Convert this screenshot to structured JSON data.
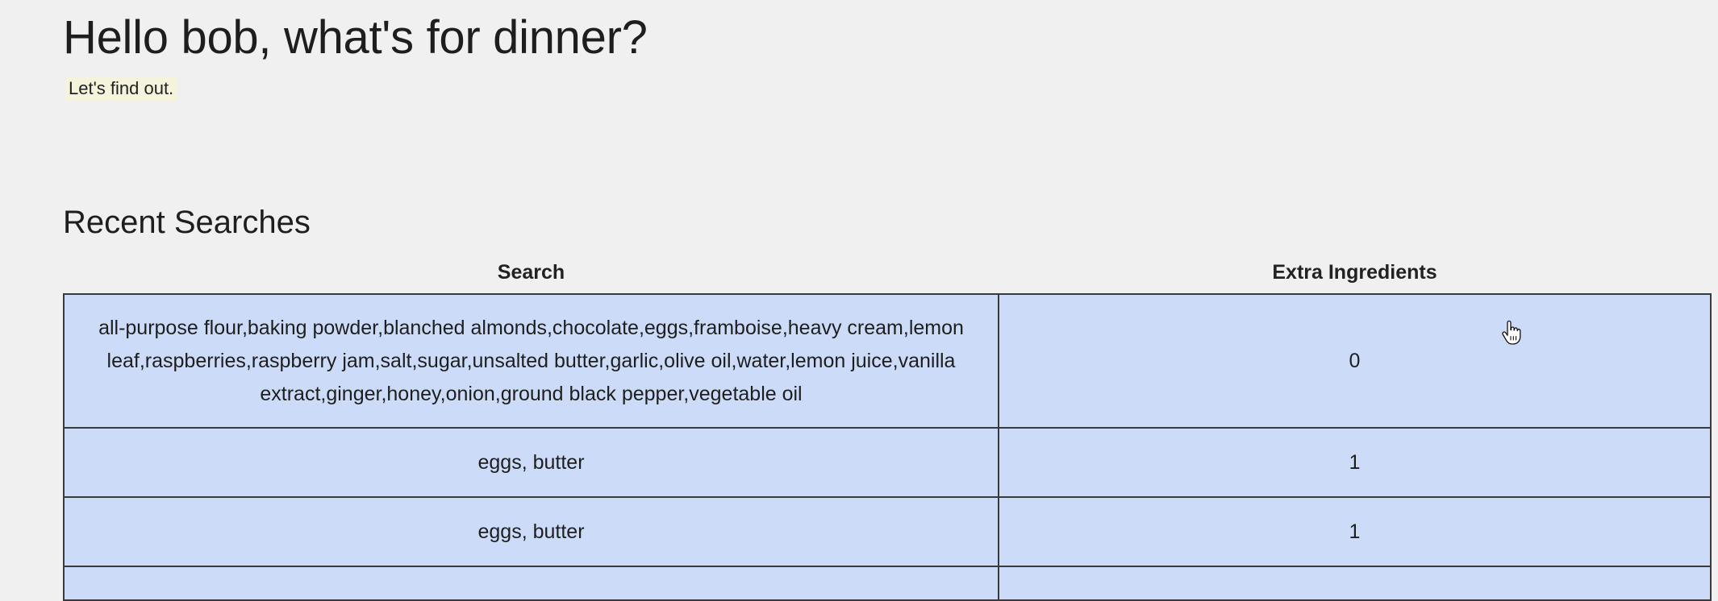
{
  "header": {
    "greeting": "Hello bob, what's for dinner?",
    "subtitle": "Let's find out."
  },
  "recent_searches": {
    "title": "Recent Searches",
    "columns": [
      "Search",
      "Extra Ingredients"
    ],
    "rows": [
      {
        "search": "all-purpose flour,baking powder,blanched almonds,chocolate,eggs,framboise,heavy cream,lemon leaf,raspberries,raspberry jam,salt,sugar,unsalted butter,garlic,olive oil,water,lemon juice,vanilla extract,ginger,honey,onion,ground black pepper,vegetable oil",
        "extra_ingredients": "0"
      },
      {
        "search": "eggs, butter",
        "extra_ingredients": "1"
      },
      {
        "search": "eggs, butter",
        "extra_ingredients": "1"
      }
    ]
  },
  "colors": {
    "background": "#f0f0f0",
    "row_fill": "#ccdcf8",
    "border": "#3a3a3a",
    "subtitle_highlight": "#f5f3dc"
  },
  "icons": {
    "cursor": "hand-pointer-icon"
  }
}
